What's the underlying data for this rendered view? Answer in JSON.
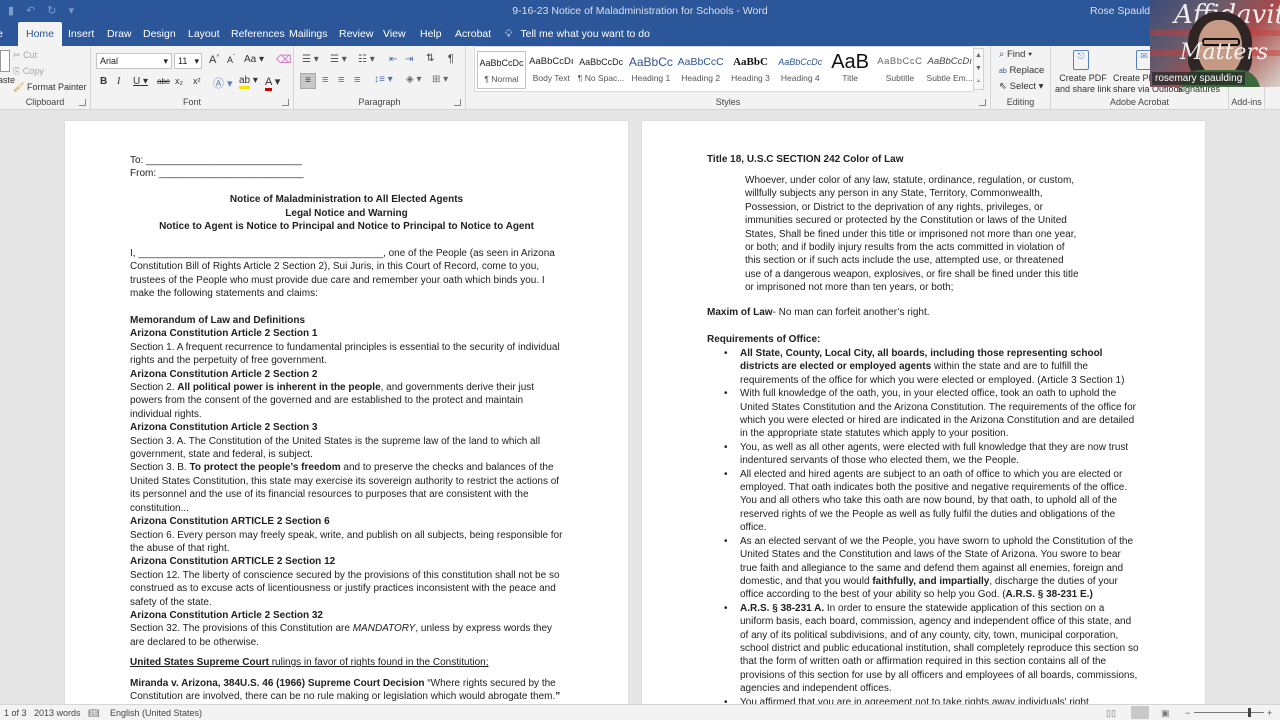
{
  "titlebar": {
    "quick_access": [
      "save-icon",
      "undo-icon",
      "redo-icon",
      "customize-icon"
    ],
    "document_title": "9-16-23 Notice of Maladministration for Schools  -  Word",
    "user_name": "Rose Spaulding"
  },
  "tabs": [
    {
      "label": "File"
    },
    {
      "label": "Home",
      "active": true
    },
    {
      "label": "Insert"
    },
    {
      "label": "Draw"
    },
    {
      "label": "Design"
    },
    {
      "label": "Layout"
    },
    {
      "label": "References"
    },
    {
      "label": "Mailings"
    },
    {
      "label": "Review"
    },
    {
      "label": "View"
    },
    {
      "label": "Help"
    },
    {
      "label": "Acrobat"
    }
  ],
  "tell_me": "Tell me what you want to do",
  "ribbon": {
    "clipboard": {
      "paste": "Paste",
      "cut": "Cut",
      "copy": "Copy",
      "format_painter": "Format Painter",
      "label": "Clipboard"
    },
    "font": {
      "name": "Arial",
      "size": "11",
      "grow": "A",
      "shrink": "A",
      "case": "Aa",
      "bold": "B",
      "italic": "I",
      "underline": "U",
      "strike": "abc",
      "subscript": "x₂",
      "superscript": "x²",
      "label": "Font",
      "highlight_color": "#f5e400",
      "font_color": "#d00000"
    },
    "paragraph": {
      "label": "Paragraph",
      "pilcrow": "¶"
    },
    "styles": {
      "label": "Styles",
      "items": [
        {
          "preview": "AaBbCcDc",
          "name": "¶ Normal",
          "selected": true
        },
        {
          "preview": "AaBbCcDı",
          "name": "Body Text"
        },
        {
          "preview": "AaBbCcDc",
          "name": "¶ No Spac..."
        },
        {
          "preview": "AaBbCc",
          "name": "Heading 1"
        },
        {
          "preview": "AaBbCcC",
          "name": "Heading 2"
        },
        {
          "preview": "AaBbC",
          "name": "Heading 3"
        },
        {
          "preview": "AaBbCcDc",
          "name": "Heading 4"
        },
        {
          "preview": "AaB",
          "name": "Title"
        },
        {
          "preview": "AaBbCcC",
          "name": "Subtitle"
        },
        {
          "preview": "AaBbCcDı",
          "name": "Subtle Em..."
        }
      ]
    },
    "editing": {
      "find": "Find",
      "replace": "Replace",
      "select": "Select",
      "label": "Editing"
    },
    "acrobat": {
      "create_pdf_1": "Create PDF",
      "create_pdf_2": "and share link",
      "create_pdf_share_1": "Create PDF and",
      "create_pdf_share_2": "share via Outlook",
      "signatures": "Signatures",
      "label": "Adobe Acrobat"
    },
    "addins": {
      "label": "Add-ins"
    }
  },
  "webcam": {
    "caption": "rosemary spaulding",
    "overlay_text_1": "Affidavit",
    "overlay_text_2": "Matters"
  },
  "page1": {
    "to": "To: ____________________________",
    "from": "From: __________________________",
    "title1": "Notice of Maladministration to All Elected Agents",
    "title2": "Legal Notice and Warning",
    "title3": "Notice to Agent is Notice to Principal and Notice to Principal to Notice to Agent",
    "intro": "I, ____________________________________________, one of the People (as seen in Arizona Constitution Bill of Rights Article 2 Section 2), Sui Juris, in this Court of Record, come to you, trustees of the People who must provide due care and remember your oath which binds you. I make the following statements and claims:",
    "memo": "Memorandum of Law and Definitions",
    "h_s1": "Arizona Constitution Article 2 Section 1",
    "s1": "Section 1. A frequent recurrence to fundamental principles is essential to the security of individual rights and the perpetuity of free government.",
    "h_s2": "Arizona Constitution Article 2 Section 2",
    "s2_a": "Section 2. ",
    "s2_b": "All political power is inherent in the people",
    "s2_c": ", and governments derive their just powers from the consent of the governed and are established to the protect and maintain individual rights.",
    "h_s3": "Arizona Constitution Article 2 Section 3",
    "s3a": "Section 3. A. The Constitution of the United States is the supreme law of the land to which all government, state and federal, is subject.",
    "s3b_a": "Section 3. B. ",
    "s3b_b": "To protect the people’s freedom",
    "s3b_c": " and to preserve the checks and balances of the United States Constitution, this state may exercise its sovereign authority to restrict the actions of its personnel and the use of its financial resources to purposes that are consistent with the constitution...",
    "h_s6": "Arizona Constitution ARTICLE 2 Section 6",
    "s6": "Section 6.  Every person may freely speak, write, and publish on all subjects, being responsible for the abuse of that right.",
    "h_s12": "Arizona Constitution ARTICLE 2 Section 12",
    "s12": "Section 12. The liberty of conscience secured by the provisions of this constitution shall not be so construed as to excuse acts of licentiousness or justify practices inconsistent with the peace and safety of the state.",
    "h_s32": "Arizona Constitution Article 2 Section 32",
    "s32_a": "Section 32. The provisions of this Constitution are ",
    "s32_b": "MANDATORY",
    "s32_c": ", unless by express words they are declared to be otherwise.",
    "scotus_a": "United States Supreme Court",
    "scotus_b": " rulings in favor of rights found in the Constitution;",
    "miranda_a": "Miranda v. Arizona, 384U.S. 46 (1966) Supreme Court Decision ",
    "miranda_b": "“Where rights secured by the Constitution are involved, there can be no rule making or legislation which would abrogate them.",
    "miranda_c": "”"
  },
  "page2": {
    "heading": "Title 18, U.S.C SECTION 242 Color of Law",
    "quote": "Whoever, under color of any law, statute, ordinance, regulation, or custom, willfully subjects any person in any State, Territory, Commonwealth, Possession, or District to the deprivation of any rights, privileges, or immunities secured or protected by the Constitution or laws of the United States, Shall be fined under this title or imprisoned not more than one year, or both; and if bodily injury results from the acts committed in violation of this section or if such acts include the use, attempted use, or threatened use of a dangerous weapon, explosives, or fire shall be fined under this title or imprisoned not more than ten years, or both;",
    "maxim_a": "Maxim of Law",
    "maxim_b": "- No man can forfeit another’s right.",
    "req_heading": "Requirements of Office:",
    "b1_a": "All State, County, Local City, all boards, including those representing school districts are elected or employed agents",
    "b1_b": " within the state and are to fulfill the requirements of the office for which you were elected or employed. (Article 3 Section 1)",
    "b2": "With full knowledge of the oath, you, in your elected office, took an oath to uphold the United States Constitution and the Arizona Constitution. The requirements of the office for which you were elected or hired are indicated in the Arizona Constitution and are detailed in the appropriate state statutes which apply to your position.",
    "b3": "You, as well as all other agents, were elected with full knowledge that they are now trust indentured servants of those who elected them, we the People.",
    "b4": "All elected and hired agents are subject to an oath of office to which you are elected or employed. That oath indicates both the positive and negative requirements of the office. You and all others who take this oath are now bound, by that oath, to uphold all of the reserved rights of we the People as well as fully fulfil the duties and obligations of the office.",
    "b5_a": "As an elected servant of we the People, you have sworn to uphold the Constitution of the United States and the Constitution and laws of the State of Arizona. You swore to bear true faith and allegiance to the same and defend them against all enemies, foreign and domestic, and that you would ",
    "b5_b": "faithfully, and impartially",
    "b5_c": ", discharge the duties of your office according to the best of your ability so help you God. (",
    "b5_d": "A.R.S. § 38-231 E.)",
    "b6_a": "A.R.S. § 38-231 A.",
    "b6_b": " In order to ensure the statewide application of this section on a uniform basis, each board, commission, agency and independent office of this state, and of any of its political subdivisions, and of any county, city, town, municipal corporation, school district and public educational institution, shall completely reproduce this section so that the form of written oath or affirmation required in this section contains all of the provisions of this section for use by all officers and employees of all boards, commissions, agencies and independent offices.",
    "b7": "You affirmed that you are in agreement not to take rights away individuals' right"
  },
  "statusbar": {
    "page": "1 of 3",
    "words": "2013 words",
    "language": "English (United States)",
    "zoom_percent": 100
  }
}
